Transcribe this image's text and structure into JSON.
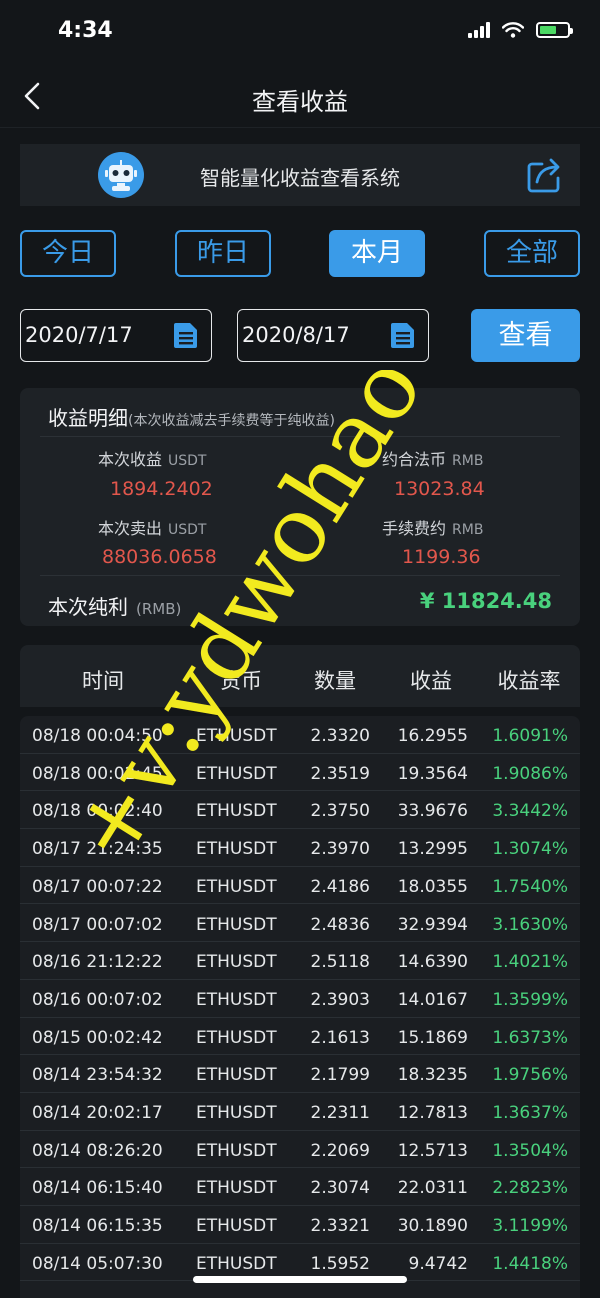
{
  "status": {
    "time": "4:34"
  },
  "nav": {
    "title": "查看收益"
  },
  "system": {
    "title": "智能量化收益查看系统"
  },
  "tabs": [
    {
      "label": "今日",
      "active": false
    },
    {
      "label": "昨日",
      "active": false
    },
    {
      "label": "本月",
      "active": true
    },
    {
      "label": "全部",
      "active": false
    }
  ],
  "filters": {
    "start_date": "2020/7/17",
    "end_date": "2020/8/17",
    "query_label": "查看"
  },
  "detail": {
    "title": "收益明细",
    "note": "(本次收益减去手续费等于纯收益)",
    "this_profit_label": "本次收益",
    "this_profit_unit": "USDT",
    "this_profit_value": "1894.2402",
    "approx_fiat_label": "约合法币",
    "approx_fiat_unit": "RMB",
    "approx_fiat_value": "13023.84",
    "this_sell_label": "本次卖出",
    "this_sell_unit": "USDT",
    "this_sell_value": "88036.0658",
    "fee_label": "手续费约",
    "fee_unit": "RMB",
    "fee_value": "1199.36",
    "net_label": "本次纯利",
    "net_unit": "(RMB)",
    "net_value": "¥ 11824.48"
  },
  "table": {
    "headers": [
      "时间",
      "货币",
      "数量",
      "收益",
      "收益率"
    ],
    "rows": [
      [
        "08/18 00:04:50",
        "ETHUSDT",
        "2.3320",
        "16.2955",
        "1.6091%"
      ],
      [
        "08/18 00:02:45",
        "ETHUSDT",
        "2.3519",
        "19.3564",
        "1.9086%"
      ],
      [
        "08/18 00:02:40",
        "ETHUSDT",
        "2.3750",
        "33.9676",
        "3.3442%"
      ],
      [
        "08/17 21:24:35",
        "ETHUSDT",
        "2.3970",
        "13.2995",
        "1.3074%"
      ],
      [
        "08/17 00:07:22",
        "ETHUSDT",
        "2.4186",
        "18.0355",
        "1.7540%"
      ],
      [
        "08/17 00:07:02",
        "ETHUSDT",
        "2.4836",
        "32.9394",
        "3.1630%"
      ],
      [
        "08/16 21:12:22",
        "ETHUSDT",
        "2.5118",
        "14.6390",
        "1.4021%"
      ],
      [
        "08/16 00:07:02",
        "ETHUSDT",
        "2.3903",
        "14.0167",
        "1.3599%"
      ],
      [
        "08/15 00:02:42",
        "ETHUSDT",
        "2.1613",
        "15.1869",
        "1.6373%"
      ],
      [
        "08/14 23:54:32",
        "ETHUSDT",
        "2.1799",
        "18.3235",
        "1.9756%"
      ],
      [
        "08/14 20:02:17",
        "ETHUSDT",
        "2.2311",
        "12.7813",
        "1.3637%"
      ],
      [
        "08/14 08:26:20",
        "ETHUSDT",
        "2.2069",
        "12.5713",
        "1.3504%"
      ],
      [
        "08/14 06:15:40",
        "ETHUSDT",
        "2.3074",
        "22.0311",
        "2.2823%"
      ],
      [
        "08/14 06:15:35",
        "ETHUSDT",
        "2.3321",
        "30.1890",
        "3.1199%"
      ],
      [
        "08/14 05:07:30",
        "ETHUSDT",
        "1.5952",
        "9.4742",
        "1.4418%"
      ]
    ]
  },
  "watermark": {
    "text": "+v:ydwohao"
  },
  "colors": {
    "accent": "#3a9be8",
    "profit_green": "#49d17d",
    "value_red": "#e2574c",
    "watermark": "#f2ea1f"
  },
  "icons": [
    "back-chevron-icon",
    "robot-icon",
    "share-icon",
    "calendar-icon"
  ]
}
